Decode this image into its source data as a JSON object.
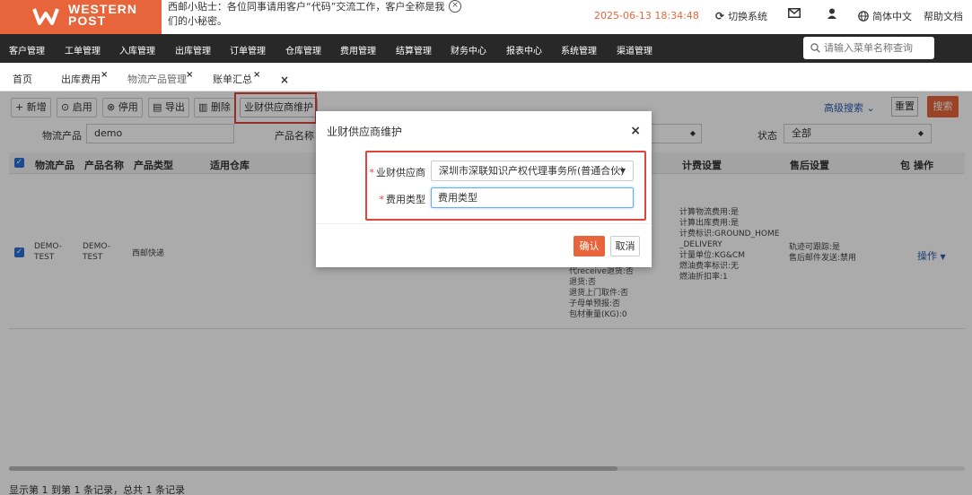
{
  "header": {
    "brand_line1": "WESTERN",
    "brand_line2": "POST",
    "tip": "西邮小贴士：各位同事请用客户“代码”交流工作，客户全称是我们的小秘密。",
    "tip_close": "×",
    "datetime": "2025-06-13 18:34:48",
    "switch_system": "切换系统",
    "language": "简体中文",
    "help": "帮助文档"
  },
  "nav": {
    "items": [
      "客户管理",
      "工单管理",
      "入库管理",
      "出库管理",
      "订单管理",
      "仓库管理",
      "费用管理",
      "结算管理",
      "财务中心",
      "报表中心",
      "系统管理",
      "渠道管理"
    ],
    "search_placeholder": "请输入菜单名称查询"
  },
  "tabs": {
    "items": [
      "首页",
      "出库费用",
      "物流产品管理",
      "账单汇总"
    ],
    "close": "×",
    "close_all": "×"
  },
  "toolbar": {
    "add": "+ 新增",
    "enable": "启用",
    "disable": "停用",
    "export": "导出",
    "delete": "删除",
    "supplier_maintain": "业财供应商维护",
    "advanced_search": "高级搜索",
    "reset": "重置",
    "search": "搜索"
  },
  "filters": {
    "logistics_product_label": "物流产品",
    "logistics_product_value": "demo",
    "product_name_label": "产品名称",
    "status_label": "状态",
    "status_value": "全部"
  },
  "table": {
    "headers": [
      "物流产品",
      "产品名称",
      "产品类型",
      "适用仓库",
      "计费设置",
      "售后设置",
      "包",
      "操作"
    ],
    "row": {
      "logistics_product": "DEMO-TEST",
      "product_name": "DEMO-TEST",
      "product_type": "西邮快递",
      "props": [
        "代receive退货:否",
        "退货:否",
        "退货上门取件:否",
        "子母单预报:否",
        "包材重量(KG):0"
      ],
      "billing": [
        "计算物流费用:是",
        "计算出库费用:是",
        "计费标识:GROUND_HOME_DELIVERY",
        "计量单位:KG&CM",
        "燃油费率标识:无",
        "燃油折扣率:1"
      ],
      "after_sale": [
        "轨迹可跟踪:是",
        "售后邮件发送:禁用"
      ],
      "action": "操作"
    }
  },
  "footer": "显示第 1 到第 1 条记录，总共 1 条记录",
  "modal": {
    "title": "业财供应商维护",
    "close": "×",
    "supplier_label": "业财供应商",
    "supplier_value": "深圳市深联知识产权代理事务所(普通合伙)",
    "fee_type_label": "费用类型",
    "fee_type_value": "费用类型",
    "required_mark": "*",
    "ok": "确认",
    "cancel": "取消"
  },
  "colors": {
    "brand": "#e8643a",
    "nav_bg": "#282828",
    "highlight": "#e0443a",
    "link": "#2a5db0"
  }
}
